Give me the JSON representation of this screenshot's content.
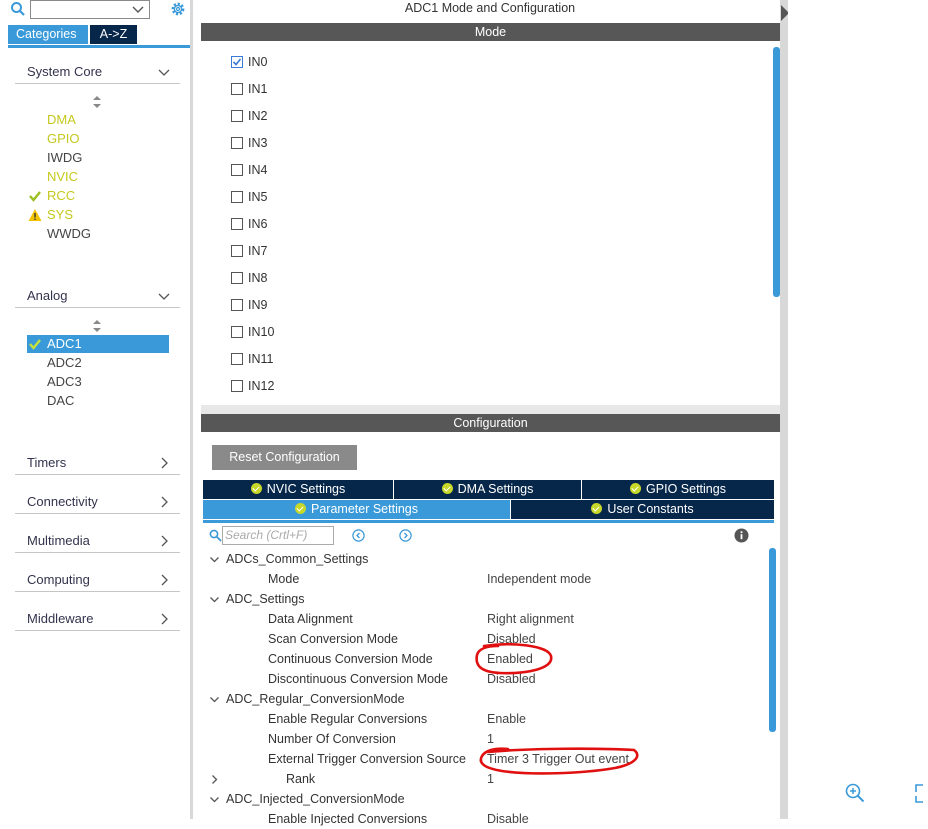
{
  "left": {
    "tabs": {
      "categories": "Categories",
      "az": "A->Z"
    },
    "categories": [
      {
        "label": "System Core"
      },
      {
        "label": "Analog"
      },
      {
        "label": "Timers"
      },
      {
        "label": "Connectivity"
      },
      {
        "label": "Multimedia"
      },
      {
        "label": "Computing"
      },
      {
        "label": "Middleware"
      }
    ],
    "system_core_items": [
      "DMA",
      "GPIO",
      "IWDG",
      "NVIC",
      "RCC",
      "SYS",
      "WWDG"
    ],
    "analog_items": [
      "ADC1",
      "ADC2",
      "ADC3",
      "DAC"
    ]
  },
  "main": {
    "title": "ADC1 Mode and Configuration",
    "mode_header": "Mode",
    "inputs": [
      "IN0",
      "IN1",
      "IN2",
      "IN3",
      "IN4",
      "IN5",
      "IN6",
      "IN7",
      "IN8",
      "IN9",
      "IN10",
      "IN11",
      "IN12"
    ],
    "config_header": "Configuration",
    "reset_button": "Reset Configuration",
    "tabs": [
      "NVIC Settings",
      "DMA Settings",
      "GPIO Settings",
      "Parameter Settings",
      "User Constants"
    ],
    "search_placeholder": "Search (Crtl+F)",
    "params": {
      "g1": "ADCs_Common_Settings",
      "mode": {
        "name": "Mode",
        "value": "Independent mode"
      },
      "g2": "ADC_Settings",
      "data_alignment": {
        "name": "Data Alignment",
        "value": "Right alignment"
      },
      "scan_mode": {
        "name": "Scan Conversion Mode",
        "value": "Disabled"
      },
      "continuous": {
        "name": "Continuous Conversion Mode",
        "value": "Enabled"
      },
      "discontinuous": {
        "name": "Discontinuous Conversion Mode",
        "value": "Disabled"
      },
      "g3": "ADC_Regular_ConversionMode",
      "enable_regular": {
        "name": "Enable Regular Conversions",
        "value": "Enable"
      },
      "num_conversion": {
        "name": "Number Of Conversion",
        "value": "1"
      },
      "ext_trigger": {
        "name": "External Trigger Conversion Source",
        "value": "Timer 3 Trigger Out event"
      },
      "rank": {
        "name": "Rank",
        "value": "1"
      },
      "g4": "ADC_Injected_ConversionMode",
      "enable_injected": {
        "name": "Enable Injected Conversions",
        "value": "Disable"
      }
    }
  },
  "colors": {
    "accent": "#3a9ad9",
    "navy": "#07274a",
    "yellow_status": "#c5c81e",
    "annotation": "#e01010"
  }
}
